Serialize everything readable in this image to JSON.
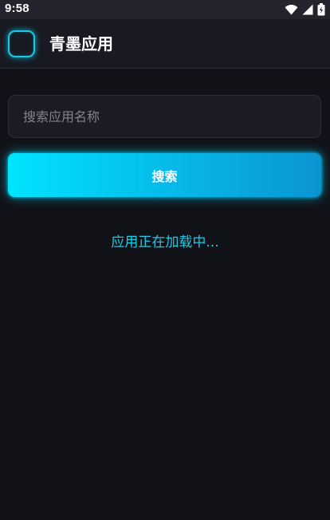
{
  "status_bar": {
    "time": "9:58",
    "icons": [
      "wifi-icon",
      "cell-signal-icon",
      "battery-icon"
    ]
  },
  "app_bar": {
    "title": "青墨应用",
    "logo_icon": "app-logo-icon"
  },
  "search": {
    "placeholder": "搜索应用名称",
    "value": "",
    "button_label": "搜索"
  },
  "status": {
    "loading_text": "应用正在加载中..."
  },
  "colors": {
    "background": "#111218",
    "accent": "#00e4ff",
    "accent_text": "#19cde6",
    "app_bar": "#181921"
  }
}
